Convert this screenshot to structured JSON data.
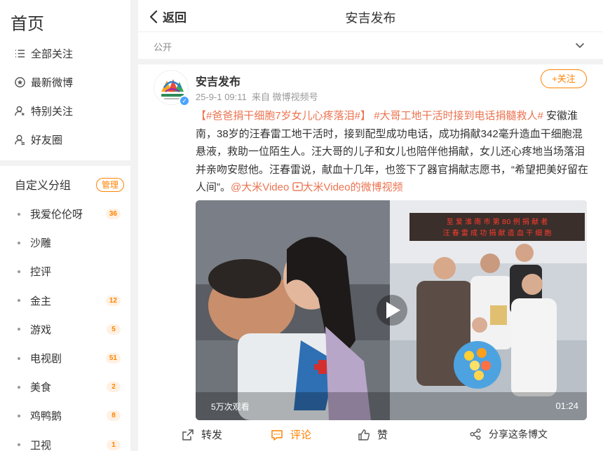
{
  "sidebar": {
    "title": "首页",
    "nav": [
      {
        "label": "全部关注",
        "icon": "list-icon"
      },
      {
        "label": "最新微博",
        "icon": "clock-star-icon"
      },
      {
        "label": "特别关注",
        "icon": "user-star-icon"
      },
      {
        "label": "好友圈",
        "icon": "user-friends-icon"
      }
    ],
    "group_title": "自定义分组",
    "manage_label": "管理",
    "groups": [
      {
        "label": "我爱伦伦呀",
        "badge": "36"
      },
      {
        "label": "沙雕",
        "badge": ""
      },
      {
        "label": "控评",
        "badge": ""
      },
      {
        "label": "金主",
        "badge": "12"
      },
      {
        "label": "游戏",
        "badge": "5"
      },
      {
        "label": "电视剧",
        "badge": "51"
      },
      {
        "label": "美食",
        "badge": "2"
      },
      {
        "label": "鸡鸭鹅",
        "badge": "8"
      },
      {
        "label": "卫视",
        "badge": "1"
      }
    ]
  },
  "topbar": {
    "back_label": "返回",
    "title": "安吉发布"
  },
  "subbar": {
    "visibility": "公开"
  },
  "post": {
    "author": "安吉发布",
    "time": "25-9-1 09:11",
    "source": "来自 微博视频号",
    "follow_label": "+关注",
    "topic1": "【#爸爸捐干细胞7岁女儿心疼落泪#】",
    "topic2": "#大哥工地干活时接到电话捐髓救人#",
    "body": " 安徽淮南，38岁的汪春雷工地干活时，接到配型成功电话，成功捐献342毫升造血干细胞混悬液，救助一位陌生人。汪大哥的儿子和女儿也陪伴他捐献，女儿还心疼地当场落泪并亲吻安慰他。汪春雷说，献血十几年，也签下了器官捐献志愿书，“希望把美好留在人间”。",
    "mention": "@大米Video",
    "video_link": "大米Video的微博视频",
    "video": {
      "views": "5万次观看",
      "duration": "01:24",
      "banner_line1": "至 爱 淮 南 市 第 80 例 捐 献 者",
      "banner_line2": "汪 春 雷 成 功 捐 献 造 血 干 细 胞"
    }
  },
  "actions": {
    "repost": "转发",
    "comment": "评论",
    "like": "赞",
    "share": "分享这条博文"
  },
  "colors": {
    "accent": "#ff8200",
    "link": "#eb7350",
    "verified": "#4aa3ff"
  }
}
